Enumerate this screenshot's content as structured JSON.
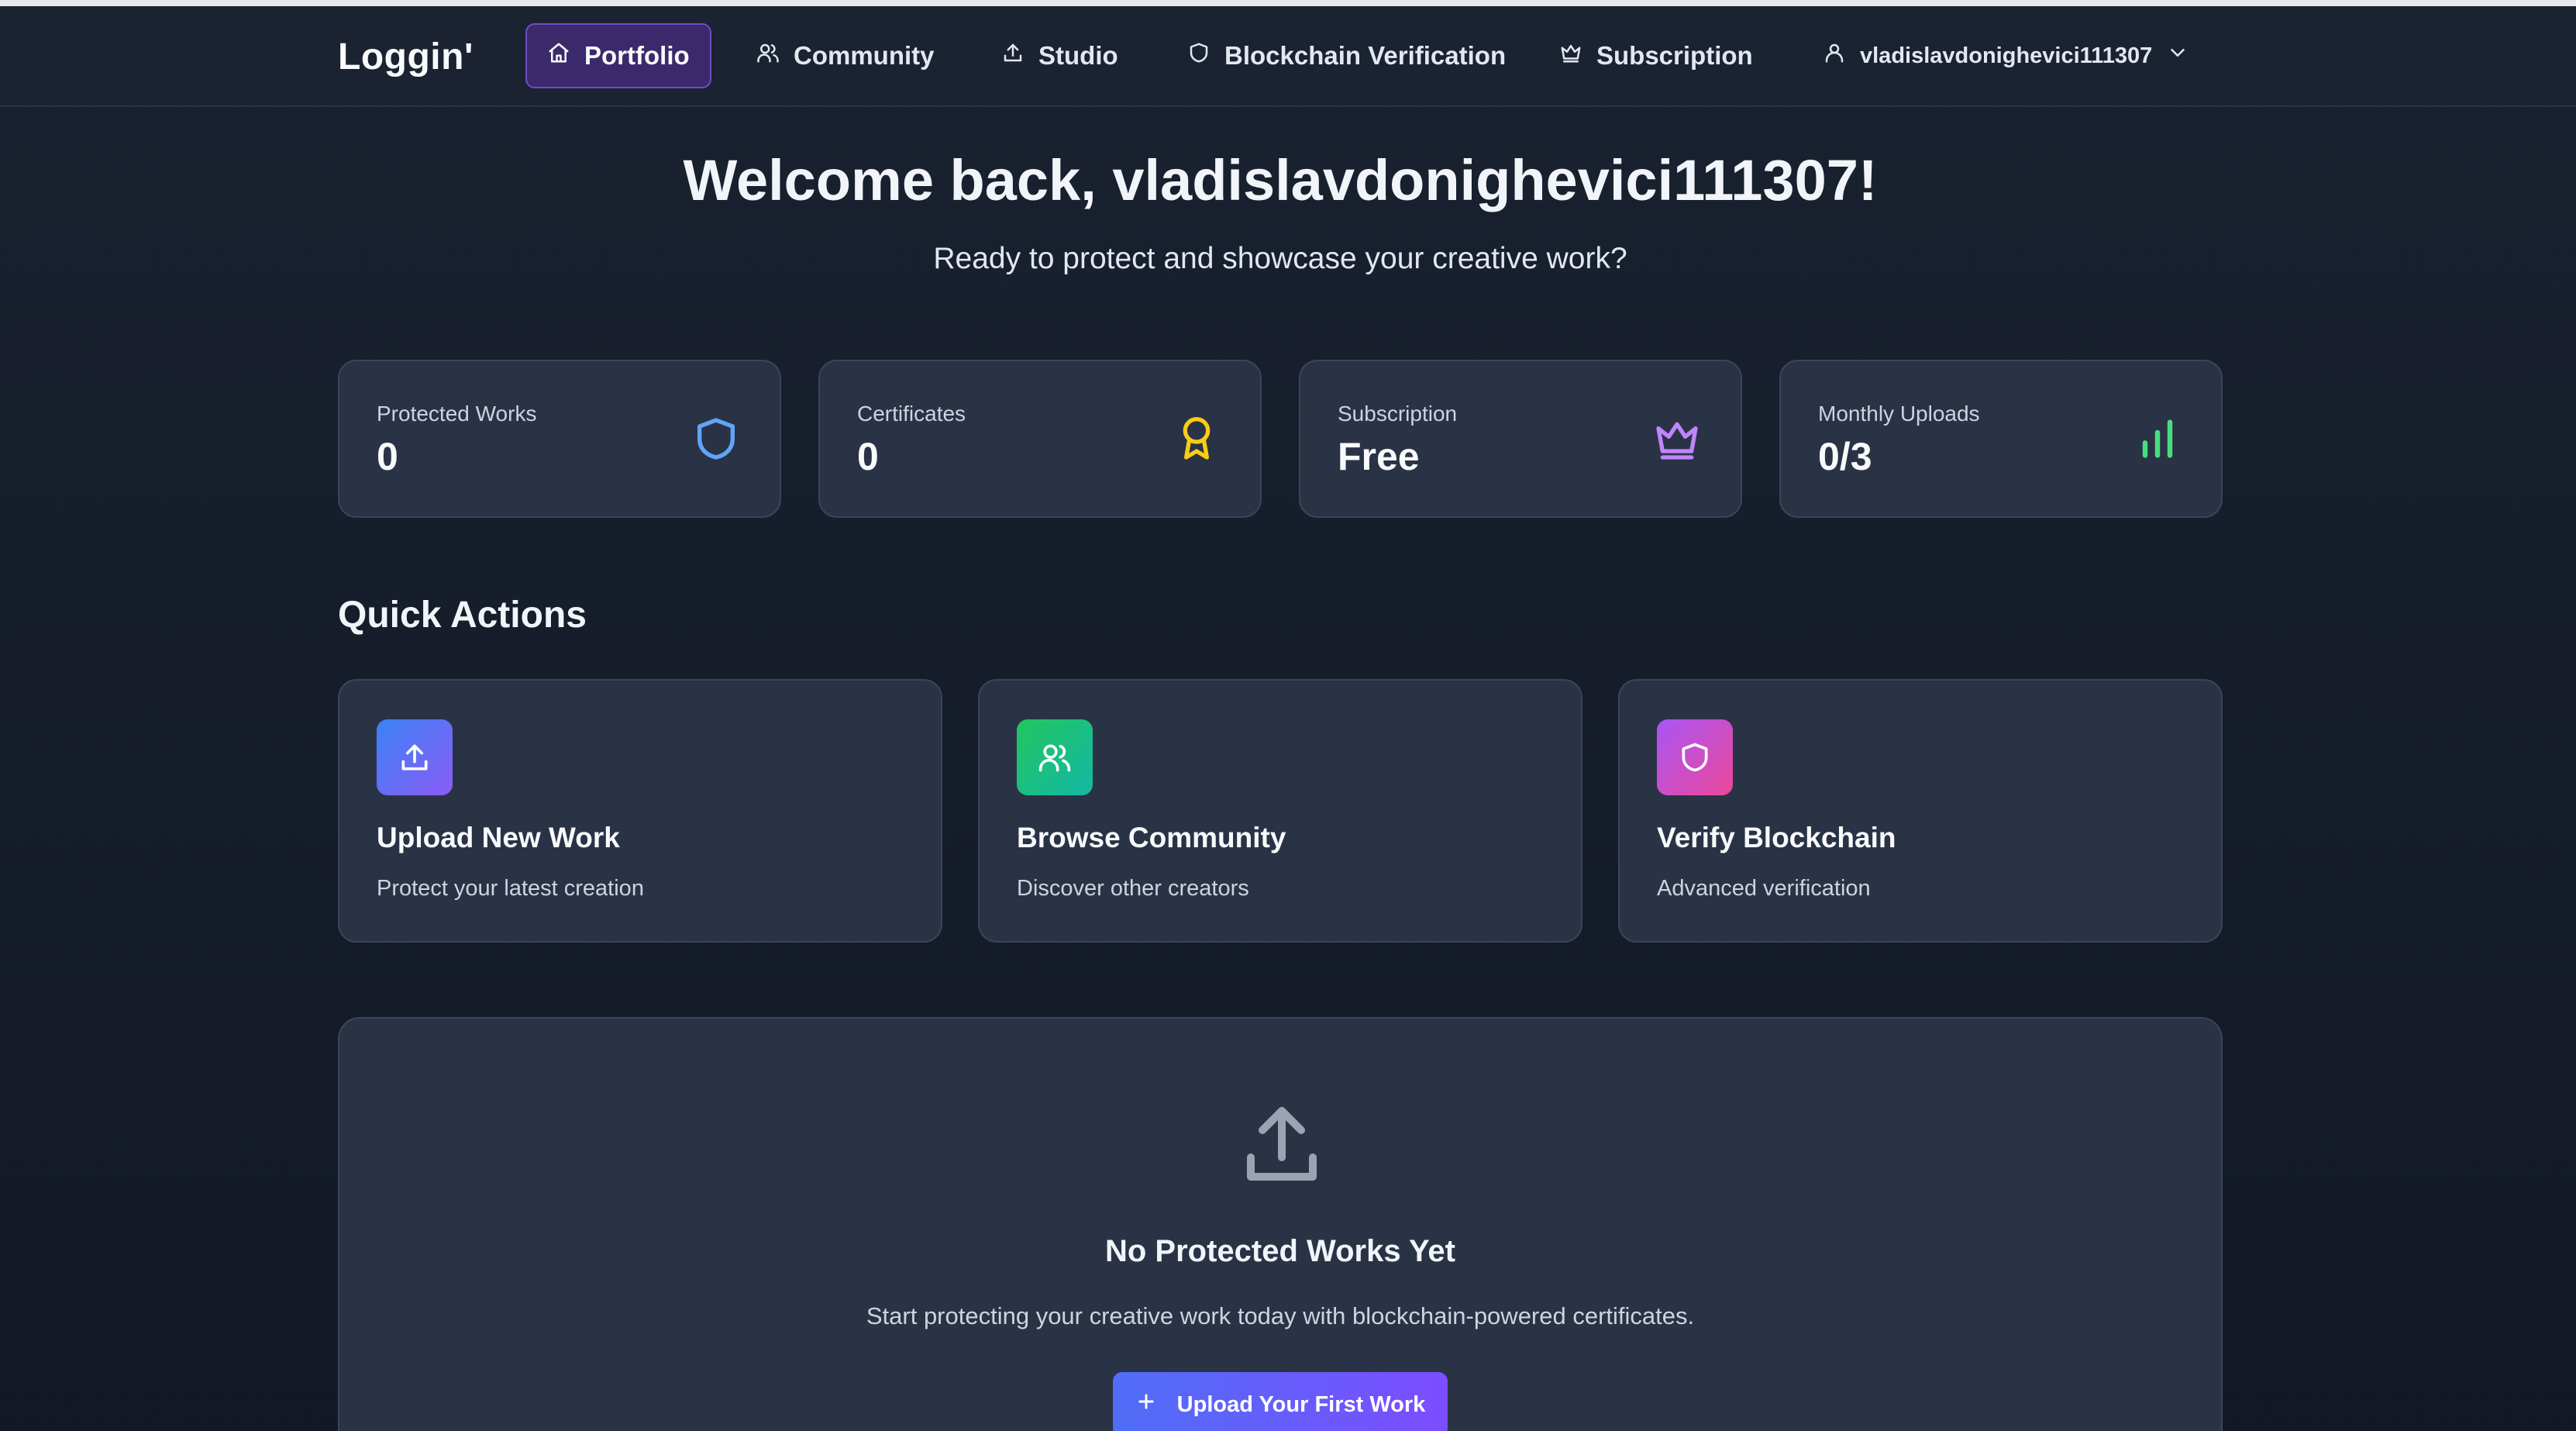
{
  "nav": {
    "brand": "Loggin'",
    "items": [
      {
        "label": "Portfolio",
        "icon": "home-icon",
        "active": true
      },
      {
        "label": "Community",
        "icon": "users-icon"
      },
      {
        "label": "Studio",
        "icon": "upload-icon"
      },
      {
        "label": "Blockchain Verification",
        "icon": "shield-icon"
      },
      {
        "label": "Subscription",
        "icon": "crown-icon"
      }
    ],
    "user": {
      "name": "vladislavdonighevici111307",
      "icon": "user-icon",
      "menu_icon": "chevron-down-icon"
    }
  },
  "welcome": {
    "title": "Welcome back, vladislavdonighevici111307!",
    "subtitle": "Ready to protect and showcase your creative work?"
  },
  "stats": [
    {
      "label": "Protected Works",
      "value": "0",
      "icon": "shield-icon",
      "color": "#60a5fa"
    },
    {
      "label": "Certificates",
      "value": "0",
      "icon": "award-icon",
      "color": "#facc15"
    },
    {
      "label": "Subscription",
      "value": "Free",
      "icon": "crown-icon",
      "color": "#c084fc"
    },
    {
      "label": "Monthly Uploads",
      "value": "0/3",
      "icon": "bar-chart-icon",
      "color": "#4ade80"
    }
  ],
  "quick_actions": {
    "title": "Quick Actions",
    "items": [
      {
        "title": "Upload New Work",
        "desc": "Protect your latest creation",
        "icon": "upload-icon",
        "gradient": [
          "#3b82f6",
          "#8b5cf6"
        ]
      },
      {
        "title": "Browse Community",
        "desc": "Discover other creators",
        "icon": "users-icon",
        "gradient": [
          "#22c55e",
          "#14b8a6"
        ]
      },
      {
        "title": "Verify Blockchain",
        "desc": "Advanced verification",
        "icon": "shield-icon",
        "gradient": [
          "#a855f7",
          "#ec4899"
        ]
      }
    ]
  },
  "empty_state": {
    "icon": "upload-icon",
    "title": "No Protected Works Yet",
    "desc": "Start protecting your creative work today with blockchain-powered certificates.",
    "button_label": "Upload Your First Work",
    "button_icon": "plus-icon"
  }
}
